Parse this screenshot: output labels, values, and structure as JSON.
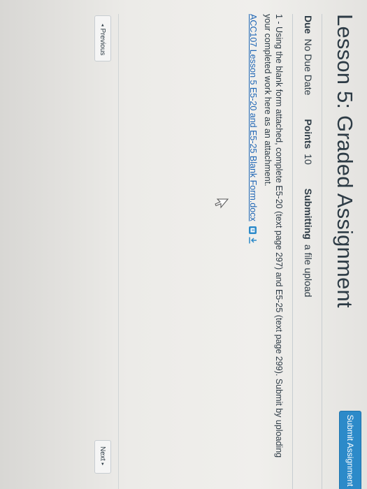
{
  "assignment": {
    "title": "Lesson 5: Graded Assignment",
    "submit_label": "Submit Assignment"
  },
  "meta": {
    "due_label": "Due",
    "due_value": "No Due Date",
    "points_label": "Points",
    "points_value": "10",
    "submitting_label": "Submitting",
    "submitting_value": "a file upload"
  },
  "description": {
    "text": "1 - Using the blank form attached, complete E5-20 (text page 297) and E5-25 (text page 299). Submit by uploading your completed work here as an attachment.",
    "attachment_link": "ACC107 Lesson 5 E5-20 and E5-25 Blank Form.docx"
  },
  "icons": {
    "preview": "preview-icon",
    "download": "download-icon",
    "cursor": "mouse-cursor-icon"
  },
  "nav": {
    "prev_label": "Previous",
    "next_label": "Next",
    "prev_arrow": "◂",
    "next_arrow": "▸"
  },
  "colors": {
    "accent": "#2c8ac9",
    "link": "#1f66b5",
    "text": "#2d3b45"
  }
}
